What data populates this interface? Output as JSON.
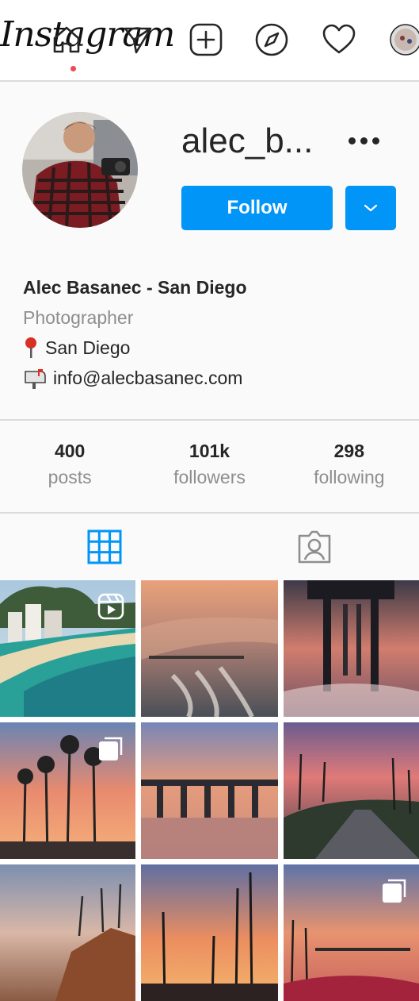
{
  "header": {
    "logo_text": "Instagram",
    "icons": [
      "home-icon",
      "direct-icon",
      "new-post-icon",
      "explore-icon",
      "activity-icon",
      "profile-avatar-icon"
    ],
    "notification_dot_color": "#ed4956"
  },
  "profile": {
    "username": "alec_b...",
    "follow_label": "Follow",
    "full_name": "Alec Basanec - San Diego",
    "category": "Photographer",
    "location": "San Diego",
    "email": "info@alecbasanec.com"
  },
  "stats": [
    {
      "value": "400",
      "label": "posts"
    },
    {
      "value": "101k",
      "label": "followers"
    },
    {
      "value": "298",
      "label": "following"
    }
  ],
  "tabs": [
    {
      "name": "posts-grid-tab",
      "icon": "grid-icon",
      "active": true
    },
    {
      "name": "tagged-tab",
      "icon": "tagged-user-icon",
      "active": false
    }
  ],
  "posts": [
    {
      "badge": "reel-icon"
    },
    {
      "badge": ""
    },
    {
      "badge": ""
    },
    {
      "badge": "carousel-icon"
    },
    {
      "badge": ""
    },
    {
      "badge": ""
    },
    {
      "badge": ""
    },
    {
      "badge": ""
    },
    {
      "badge": "carousel-icon"
    }
  ],
  "colors": {
    "accent": "#0095f6",
    "text": "#262626",
    "muted": "#8e8e8e",
    "border": "#dbdbdb"
  }
}
